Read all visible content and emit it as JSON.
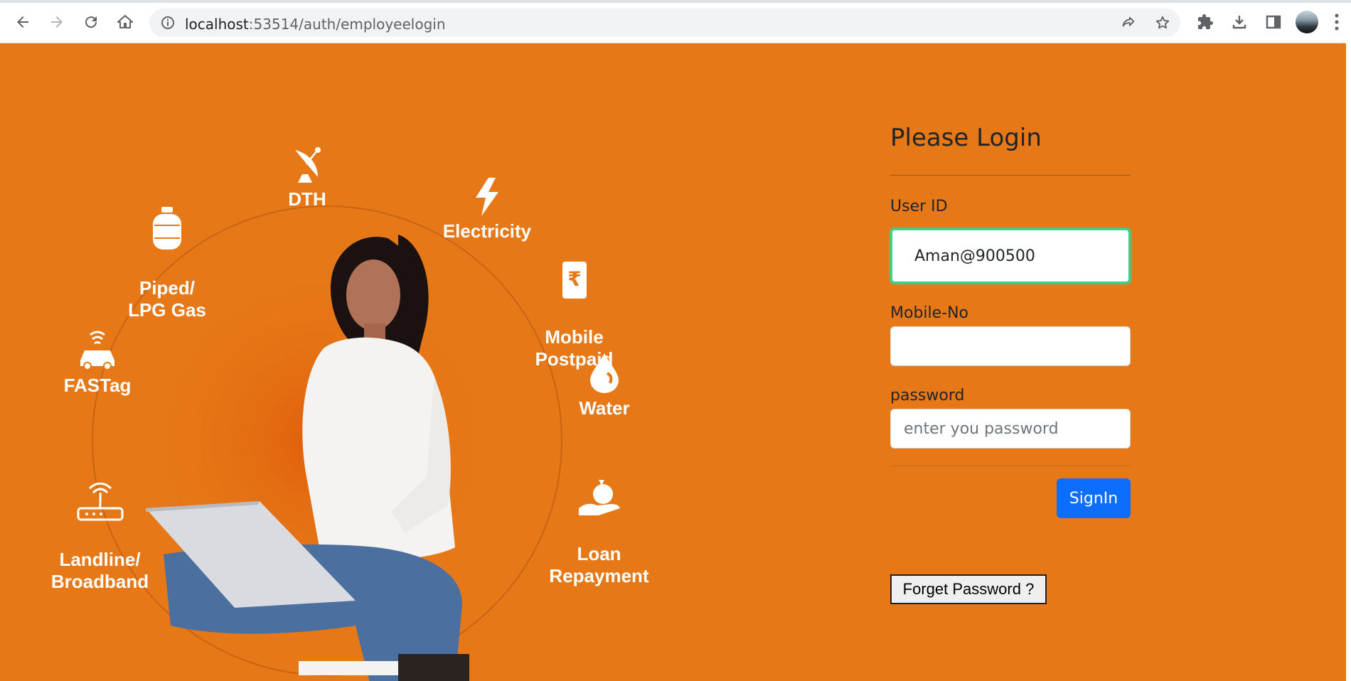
{
  "browser": {
    "url_host": "localhost",
    "url_rest": ":53514/auth/employeelogin",
    "icons": [
      "back-icon",
      "forward-icon",
      "reload-icon",
      "home-icon",
      "site-info-icon",
      "share-icon",
      "bookmark-star-icon",
      "extensions-icon",
      "download-icon",
      "side-panel-icon",
      "profile-avatar",
      "menu-icon"
    ]
  },
  "hero": {
    "services": [
      {
        "label": "DTH",
        "icon": "satellite-dish-icon"
      },
      {
        "label": "Electricity",
        "icon": "lightning-icon"
      },
      {
        "label": "Piped/\nLPG Gas",
        "icon": "gas-cylinder-icon"
      },
      {
        "label": "Mobile\nPostpaid",
        "icon": "rupee-phone-icon"
      },
      {
        "label": "FASTag",
        "icon": "car-tag-icon"
      },
      {
        "label": "Water",
        "icon": "water-drop-icon"
      },
      {
        "label": "Landline/\nBroadband",
        "icon": "router-icon"
      },
      {
        "label": "Loan\nRepayment",
        "icon": "money-bag-hand-icon"
      }
    ]
  },
  "login": {
    "title": "Please Login",
    "user_id_label": "User ID",
    "user_id_value": "Aman@900500",
    "mobile_label": "Mobile-No",
    "mobile_value": "",
    "password_label": "password",
    "password_placeholder": "enter you password",
    "signin_label": "SignIn",
    "forget_label": "Forget Password ?"
  },
  "colors": {
    "background": "#e67817",
    "primary_button": "#0d6efd",
    "focus_border": "#33d690"
  }
}
